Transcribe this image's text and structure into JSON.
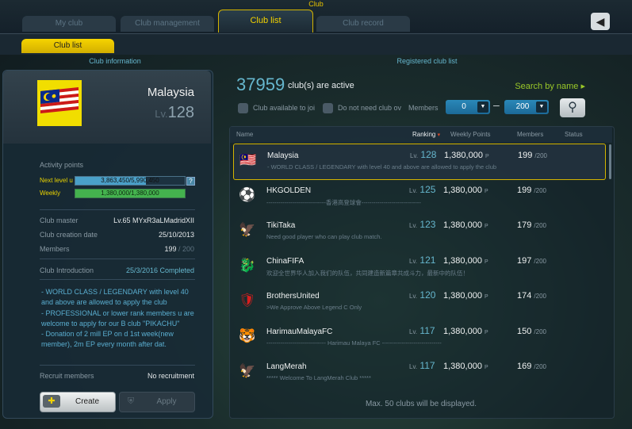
{
  "header": {
    "caption": "Club",
    "tabs": [
      "My club",
      "Club management",
      "Club list",
      "Club record"
    ],
    "back_icon": "back-arrow-icon",
    "subtab": "Club list"
  },
  "sections": {
    "info": "Club information",
    "list": "Registered club list"
  },
  "club_info": {
    "flag_icon": "malaysia-flag-icon",
    "name": "Malaysia",
    "lv_prefix": "Lv.",
    "level": "128",
    "activity_title": "Activity points",
    "next_level_label": "Next level u",
    "next_level_text": "3,863,450/5,990,450",
    "next_level_progress": 0.645,
    "weekly_label": "Weekly",
    "weekly_text": "1,380,000/1,380,000",
    "weekly_progress": 1.0,
    "help": "?",
    "master_label": "Club master",
    "master_value": "Lv.65 MYxR3aLMadridXII",
    "created_label": "Club creation date",
    "created_value": "25/10/2013",
    "members_label": "Members",
    "members_value": "199",
    "members_max": " / 200",
    "intro_label": "Club Introduction",
    "intro_status": "25/3/2016 Completed",
    "intro_lines": [
      "- WORLD CLASS / LEGENDARY with level 40",
      "and above are allowed to apply the club",
      "- PROFESSIONAL or lower rank members u are",
      "welcome to apply for our B club \"PIKACHU\"",
      "- Donation of 2 mill EP on d 1st week(new",
      "member), 2m EP every month after dat."
    ],
    "recruit_label": "Recruit members",
    "recruit_value": "No recruitment",
    "create_label": "Create",
    "apply_label": "Apply"
  },
  "list": {
    "active_count": "37959",
    "active_text": "club(s) are active",
    "search_by_name": "Search by name ▸",
    "filter1": "Club available to joi",
    "filter2": "Do not need club ov",
    "members_label": "Members",
    "min_value": "0",
    "max_value": "200",
    "dash": "–",
    "columns": {
      "name": "Name",
      "ranking": "Ranking",
      "ranking_arrow": "▾",
      "weekly": "Weekly Points",
      "members": "Members",
      "status": "Status"
    },
    "rows": [
      {
        "name": "Malaysia",
        "desc": "- WORLD CLASS / LEGENDARY with level 40   and above are allowed to apply the club",
        "lv_prefix": "Lv.",
        "level": "128",
        "points": "1,380,000",
        "unit": "P",
        "members": "199",
        "max": "/200",
        "emblem": "🇲🇾",
        "emblem_icon": "malaysia-flag-icon"
      },
      {
        "name": "HKGOLDEN",
        "desc": "------------------------------香港高登球會------------------------------",
        "lv_prefix": "Lv.",
        "level": "125",
        "points": "1,380,000",
        "unit": "P",
        "members": "199",
        "max": "/200",
        "emblem": "⚽",
        "emblem_icon": "hkgolden-emblem-icon"
      },
      {
        "name": "TikiTaka",
        "desc": "Need good player who can play club match.",
        "lv_prefix": "Lv.",
        "level": "123",
        "points": "1,380,000",
        "unit": "P",
        "members": "179",
        "max": "/200",
        "emblem": "🦅",
        "emblem_icon": "eagle-crest-icon"
      },
      {
        "name": "ChinaFIFA",
        "desc": "欢迎全世界华人加入我们的队伍，共同建造新篇章共成斗力，最新中的队伍！",
        "lv_prefix": "Lv.",
        "level": "121",
        "points": "1,380,000",
        "unit": "P",
        "members": "197",
        "max": "/200",
        "emblem": "🐉",
        "emblem_icon": "red-dragon-icon"
      },
      {
        "name": "BrothersUnited",
        "desc": ">We Approve Above Legend C Only",
        "lv_prefix": "Lv.",
        "level": "120",
        "points": "1,380,000",
        "unit": "P",
        "members": "174",
        "max": "/200",
        "emblem": "🛡",
        "emblem_icon": "red-shield-icon"
      },
      {
        "name": "HarimauMalayaFC",
        "desc": "------------------------------ Harimau Malaya FC ------------------------------",
        "lv_prefix": "Lv.",
        "level": "117",
        "points": "1,380,000",
        "unit": "P",
        "members": "150",
        "max": "/200",
        "emblem": "🐯",
        "emblem_icon": "tiger-emblem-icon"
      },
      {
        "name": "LangMerah",
        "desc": "***** Welcome To LangMerah Club *****",
        "lv_prefix": "Lv.",
        "level": "117",
        "points": "1,380,000",
        "unit": "P",
        "members": "169",
        "max": "/200",
        "emblem": "🦅",
        "emblem_icon": "red-eagle-icon"
      }
    ],
    "footer": "Max. 50 clubs will be displayed."
  }
}
